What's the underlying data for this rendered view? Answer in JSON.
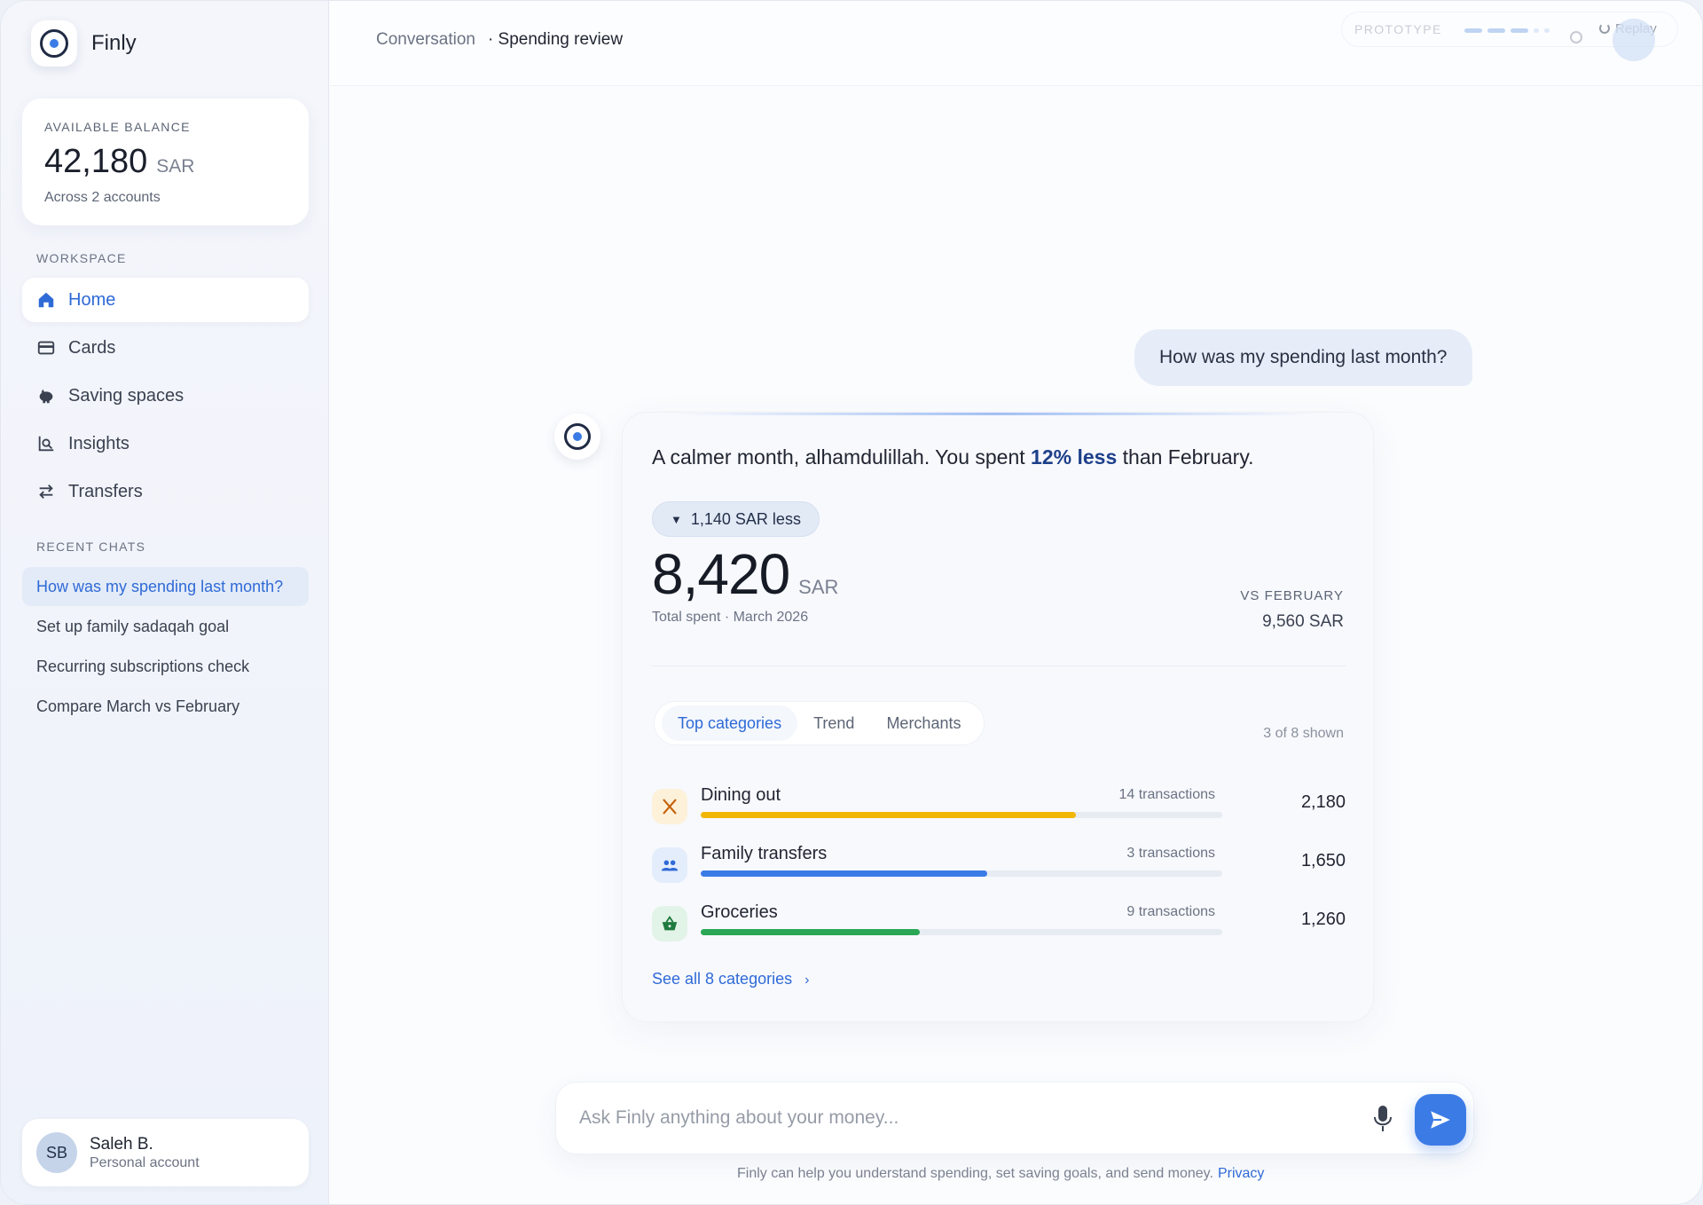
{
  "app": {
    "name": "Finly"
  },
  "balance": {
    "label": "AVAILABLE BALANCE",
    "amount": "42,180",
    "currency": "SAR",
    "sub": "Across 2 accounts"
  },
  "sidebar": {
    "workspace_label": "WORKSPACE",
    "nav": [
      {
        "label": "Home",
        "icon": "home-icon",
        "active": true
      },
      {
        "label": "Cards",
        "icon": "card-icon"
      },
      {
        "label": "Saving spaces",
        "icon": "piggy-bank-icon"
      },
      {
        "label": "Insights",
        "icon": "insights-icon"
      },
      {
        "label": "Transfers",
        "icon": "transfer-icon"
      }
    ],
    "recent_label": "RECENT CHATS",
    "chats": [
      {
        "label": "How was my spending last month?",
        "active": true
      },
      {
        "label": "Set up family sadaqah goal"
      },
      {
        "label": "Recurring subscriptions check"
      },
      {
        "label": "Compare March vs February"
      }
    ]
  },
  "user": {
    "initials": "SB",
    "name": "Saleh B.",
    "account": "Personal account"
  },
  "header": {
    "crumb_parent": "Conversation",
    "crumb_current": "· Spending review",
    "prototype_label": "PROTOTYPE",
    "replay_label": "Replay"
  },
  "conversation": {
    "user_message": "How was my spending last month?",
    "lead_prefix": "A calmer month, alhamdulillah. You spent ",
    "lead_highlight": "12% less",
    "lead_suffix": " than February.",
    "change_pill": "1,140 SAR less",
    "total_amount": "8,420",
    "total_currency": "SAR",
    "total_sub": "Total spent · March 2026",
    "vs_label": "VS FEBRUARY",
    "vs_value": "9,560 SAR",
    "tabs": [
      "Top categories",
      "Trend",
      "Merchants"
    ],
    "shown": "3 of 8 shown",
    "categories": [
      {
        "name": "Dining out",
        "transactions": "14 transactions",
        "value": "2,180",
        "share": 0.72,
        "color": "#f2b705",
        "icon_bg": "#fdf1da",
        "icon": "utensils-icon"
      },
      {
        "name": "Family transfers",
        "transactions": "3 transactions",
        "value": "1,650",
        "share": 0.55,
        "color": "#3b7be6",
        "icon_bg": "#e4edfb",
        "icon": "people-icon"
      },
      {
        "name": "Groceries",
        "transactions": "9 transactions",
        "value": "1,260",
        "share": 0.42,
        "color": "#2aa655",
        "icon_bg": "#e2f3e7",
        "icon": "basket-icon"
      }
    ],
    "see_all": "See all 8 categories"
  },
  "composer": {
    "placeholder": "Ask Finly anything about your money..."
  },
  "footnote": {
    "text": "Finly can help you understand spending, set saving goals, and send money.",
    "link": "Privacy"
  },
  "colors": {
    "accent": "#3b7be6",
    "highlight": "#1d3f8a"
  }
}
